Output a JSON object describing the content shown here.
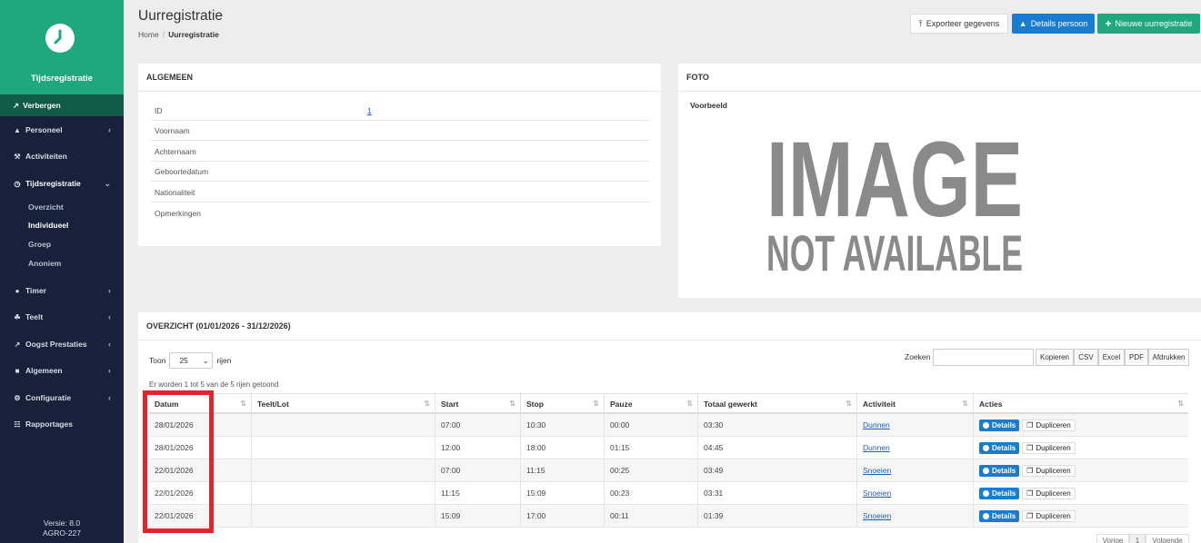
{
  "sidebar": {
    "brand": "Tijdsregistratie",
    "hide_label": "Verbergen",
    "items": [
      {
        "label": "Personeel",
        "icon": "person-icon"
      },
      {
        "label": "Activiteiten",
        "icon": "tools-icon"
      },
      {
        "label": "Tijdsregistratie",
        "icon": "clock-icon"
      },
      {
        "label": "Timer",
        "icon": "stopwatch-icon"
      },
      {
        "label": "Teelt",
        "icon": "leaf-icon"
      },
      {
        "label": "Oogst Prestaties",
        "icon": "chart-icon"
      },
      {
        "label": "Algemeen",
        "icon": "factory-icon"
      },
      {
        "label": "Configuratie",
        "icon": "gears-icon"
      },
      {
        "label": "Rapportages",
        "icon": "report-icon"
      }
    ],
    "subitems": [
      "Overzicht",
      "Individueel",
      "Groep",
      "Anoniem"
    ],
    "version": "Versie: 8.0",
    "build": "AGRO-227"
  },
  "header": {
    "title": "Uurregistratie",
    "breadcrumb_home": "Home",
    "breadcrumb_current": "Uurregistratie",
    "btn_export": "Exporteer gegevens",
    "btn_details": "Details persoon",
    "btn_new": "Nieuwe uurregistratie"
  },
  "general": {
    "title": "ALGEMEEN",
    "rows": [
      {
        "label": "ID",
        "value": "1"
      },
      {
        "label": "Voornaam",
        "value": ""
      },
      {
        "label": "Achternaam",
        "value": ""
      },
      {
        "label": "Geboortedatum",
        "value": ""
      },
      {
        "label": "Nationaliteit",
        "value": ""
      },
      {
        "label": "Opmerkingen",
        "value": ""
      }
    ]
  },
  "foto": {
    "title": "FOTO",
    "label": "Voorbeeld",
    "image_line1": "IMAGE",
    "image_line2": "NOT AVAILABLE"
  },
  "overview": {
    "title": "OVERZICHT (01/01/2026 - 31/12/2026)",
    "show_prefix": "Toon",
    "show_value": "25",
    "show_suffix": "rijen",
    "search_label": "Zoeken",
    "export_buttons": [
      "Kopieren",
      "CSV",
      "Excel",
      "PDF",
      "Afdrukken"
    ],
    "info": "Er worden 1 tot 5 van de 5 rijen getoond",
    "columns": [
      "Datum",
      "Teelt/Lot",
      "Start",
      "Stop",
      "Pauze",
      "Totaal gewerkt",
      "Activiteit",
      "Acties"
    ],
    "rows": [
      {
        "datum": "28/01/2026",
        "teelt": "",
        "start": "07:00",
        "stop": "10:30",
        "pauze": "00:00",
        "totaal": "03:30",
        "activiteit": "Dunnen"
      },
      {
        "datum": "28/01/2026",
        "teelt": "",
        "start": "12:00",
        "stop": "18:00",
        "pauze": "01:15",
        "totaal": "04:45",
        "activiteit": "Dunnen"
      },
      {
        "datum": "22/01/2026",
        "teelt": "",
        "start": "07:00",
        "stop": "11:15",
        "pauze": "00:25",
        "totaal": "03:49",
        "activiteit": "Snoeien"
      },
      {
        "datum": "22/01/2026",
        "teelt": "",
        "start": "11:15",
        "stop": "15:09",
        "pauze": "00:23",
        "totaal": "03:31",
        "activiteit": "Snoeien"
      },
      {
        "datum": "22/01/2026",
        "teelt": "",
        "start": "15:09",
        "stop": "17:00",
        "pauze": "00:11",
        "totaal": "01:39",
        "activiteit": "Snoeien"
      }
    ],
    "action_details": "Details",
    "action_duplicate": "Dupliceren",
    "pager_prev": "Vorige",
    "pager_page": "1",
    "pager_next": "Volgende"
  },
  "colors": {
    "brand_green": "#1fa87d",
    "sidebar_dark": "#18213a",
    "primary_blue": "#1a7ccf",
    "highlight_red": "#e0262b"
  }
}
